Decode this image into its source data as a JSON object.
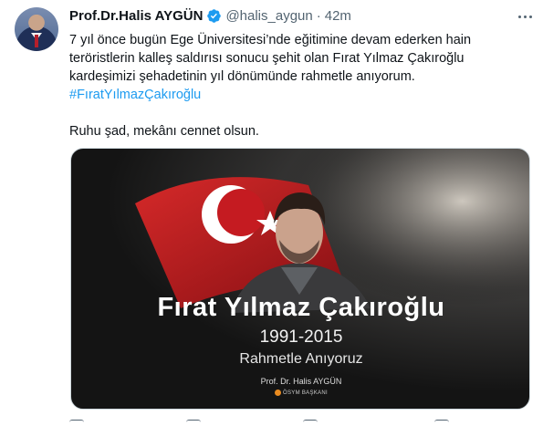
{
  "author": {
    "name": "Prof.Dr.Halis AYGÜN",
    "handle": "@halis_aygun",
    "separator": "·",
    "time": "42m"
  },
  "tweet": {
    "line1": "7 yıl önce bugün Ege Üniversitesi’nde eğitimine devam ederken hain",
    "line2": "teröristlerin kalleş saldırısı sonucu şehit olan Fırat Yılmaz Çakıroğlu",
    "line3": "kardeşimizi şehadetinin yıl dönümünde rahmetle anıyorum.",
    "hashtag": "#FıratYılmazÇakıroğlu",
    "line5": "Ruhu şad, mekânı cennet olsun."
  },
  "media": {
    "name_text": "Fırat Yılmaz Çakıroğlu",
    "years_text": "1991-2015",
    "remember_text": "Rahmetle Anıyoruz",
    "signature_text": "Prof. Dr. Halis AYGÜN",
    "org_text": "ÖSYM BAŞKANI"
  },
  "icons": {
    "verified": "verified-badge-icon",
    "more": "more-options-icon",
    "reply": "reply-icon",
    "retweet": "retweet-icon",
    "like": "like-icon",
    "share": "share-icon"
  },
  "colors": {
    "accent": "#1d9bf0",
    "text": "#0f1419",
    "secondary": "#536471",
    "flag_red": "#d81c25"
  }
}
